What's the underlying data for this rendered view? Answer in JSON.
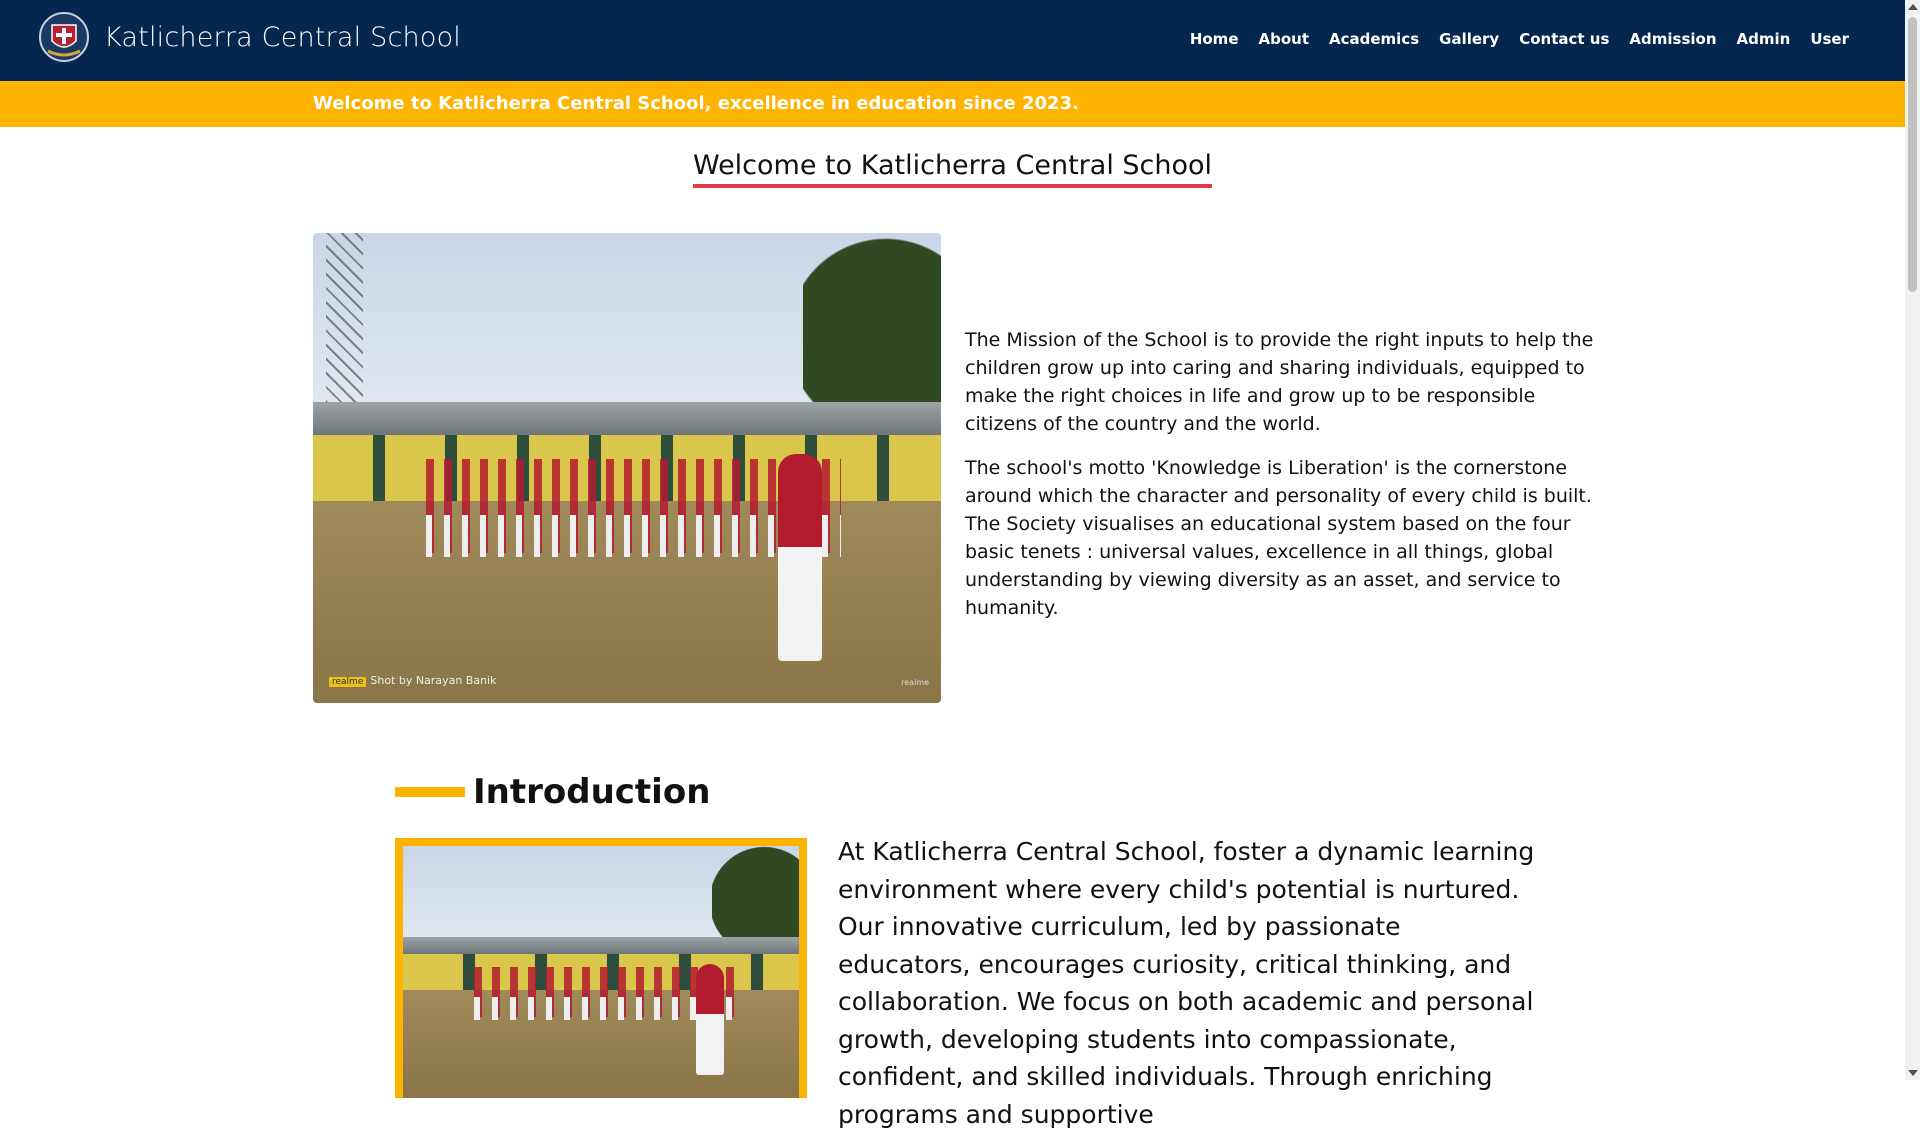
{
  "header": {
    "brand": "Katlicherra Central School",
    "nav": [
      "Home",
      "About",
      "Academics",
      "Gallery",
      "Contact us",
      "Admission",
      "Admin",
      "User"
    ]
  },
  "announcement": "Welcome to Katlicherra Central School, excellence in education since 2023.",
  "welcome": {
    "title": "Welcome to Katlicherra Central School",
    "photo_caption_tag": "realme",
    "photo_caption": "Shot by Narayan Banik",
    "photo_brand": "realme",
    "paragraphs": [
      "The Mission of the School is to provide the right inputs to help the children grow up into caring and sharing individuals, equipped to make the right choices in life and grow up to be responsible citizens of the country and the world.",
      "The school's motto 'Knowledge is Liberation' is the cornerstone around which the character and personality of every child is built. The Society visualises an educational system based on the four basic tenets : universal values, excellence in all things, global understanding by viewing diversity as an asset, and service to humanity."
    ]
  },
  "introduction": {
    "heading": "Introduction",
    "text": "At Katlicherra Central School, foster a dynamic learning environment where every child's potential is nurtured. Our innovative curriculum, led by passionate educators, encourages curiosity, critical thinking, and collaboration. We focus on both academic and personal growth, developing students into compassionate, confident, and skilled individuals. Through enriching programs and supportive"
  },
  "colors": {
    "navbar": "#04264f",
    "accent_yellow": "#fdb400",
    "title_underline": "#e23a4a"
  },
  "icons": {
    "logo": "school-crest-icon"
  }
}
